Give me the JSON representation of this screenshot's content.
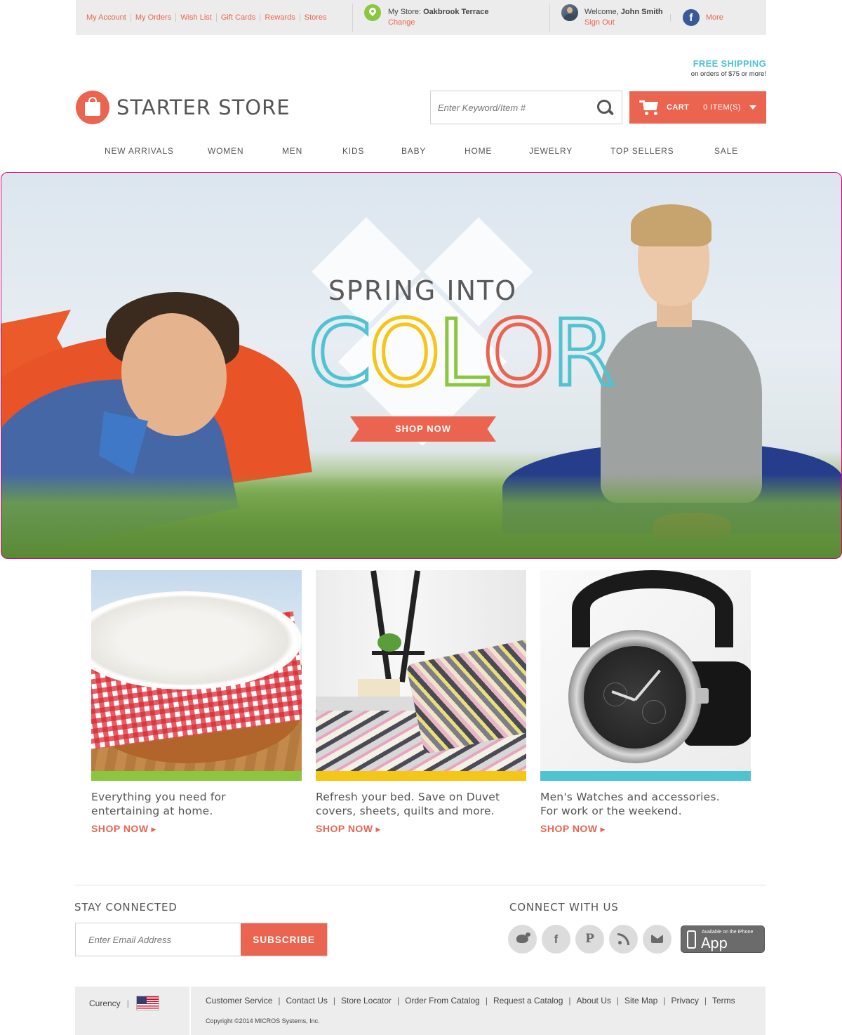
{
  "utility": {
    "links": [
      "My Account",
      "My Orders",
      "Wish List",
      "Gift Cards",
      "Rewards",
      "Stores"
    ],
    "store_prefix": "My Store: ",
    "store_name": "Oakbrook Terrace",
    "store_change": "Change",
    "welcome_prefix": "Welcome, ",
    "user_name": "John Smith",
    "sign_out": "Sign Out",
    "more": "More",
    "pipe": "|",
    "fb_glyph": "f"
  },
  "header": {
    "free_shipping": "FREE SHIPPING",
    "free_shipping_sub": "on orders of $75 or more!",
    "logo_text": "STARTER STORE",
    "search_placeholder": "Enter Keyword/Item #",
    "cart_label": "CART",
    "cart_count": "0 ITEM(S)"
  },
  "nav": {
    "items": [
      "NEW ARRIVALS",
      "WOMEN",
      "MEN",
      "KIDS",
      "BABY",
      "HOME",
      "JEWELRY",
      "TOP SELLERS",
      "SALE"
    ]
  },
  "hero": {
    "title": "SPRING INTO",
    "color_letters": [
      "C",
      "O",
      "L",
      "O",
      "R"
    ],
    "cta": "SHOP NOW"
  },
  "promos": [
    {
      "text": "Everything you need for entertaining at home.",
      "link": "SHOP NOW",
      "bar_color": "#8cc63f"
    },
    {
      "text": "Refresh your bed. Save on Duvet covers, sheets, quilts and more.",
      "link": "SHOP NOW",
      "bar_color": "#f5c518"
    },
    {
      "text": "Men's Watches and accessories. For work or the weekend.",
      "link": "SHOP NOW",
      "bar_color": "#4fc3cf"
    }
  ],
  "footer": {
    "stay_connected": "STAY CONNECTED",
    "email_placeholder": "Enter Email Address",
    "subscribe": "SUBSCRIBE",
    "connect_with_us": "CONNECT WITH US",
    "social_icons": [
      "twitter-icon",
      "facebook-icon",
      "pinterest-icon",
      "rss-icon",
      "mail-icon"
    ],
    "facebook_glyph": "f",
    "pinterest_glyph": "P",
    "appstore_small": "Available on the iPhone",
    "appstore_big": "App Store",
    "currency_label": "Curency",
    "currency_pipe": "|",
    "links": [
      "Customer Service",
      "Contact Us",
      "Store Locator",
      "Order From Catalog",
      "Request a Catalog",
      "About Us",
      "Site Map",
      "Privacy",
      "Terms"
    ],
    "link_separator": "|",
    "copyright": "Copyright ©2014 MICROS Systems, Inc."
  },
  "colors": {
    "accent": "#ea6450",
    "teal": "#4fc3cf",
    "green": "#8cc63f",
    "yellow": "#f5c518",
    "color_letter_strokes": [
      "#4fc3cf",
      "#f5c518",
      "#8cc63f",
      "#ea6450",
      "#4fc3cf"
    ]
  }
}
